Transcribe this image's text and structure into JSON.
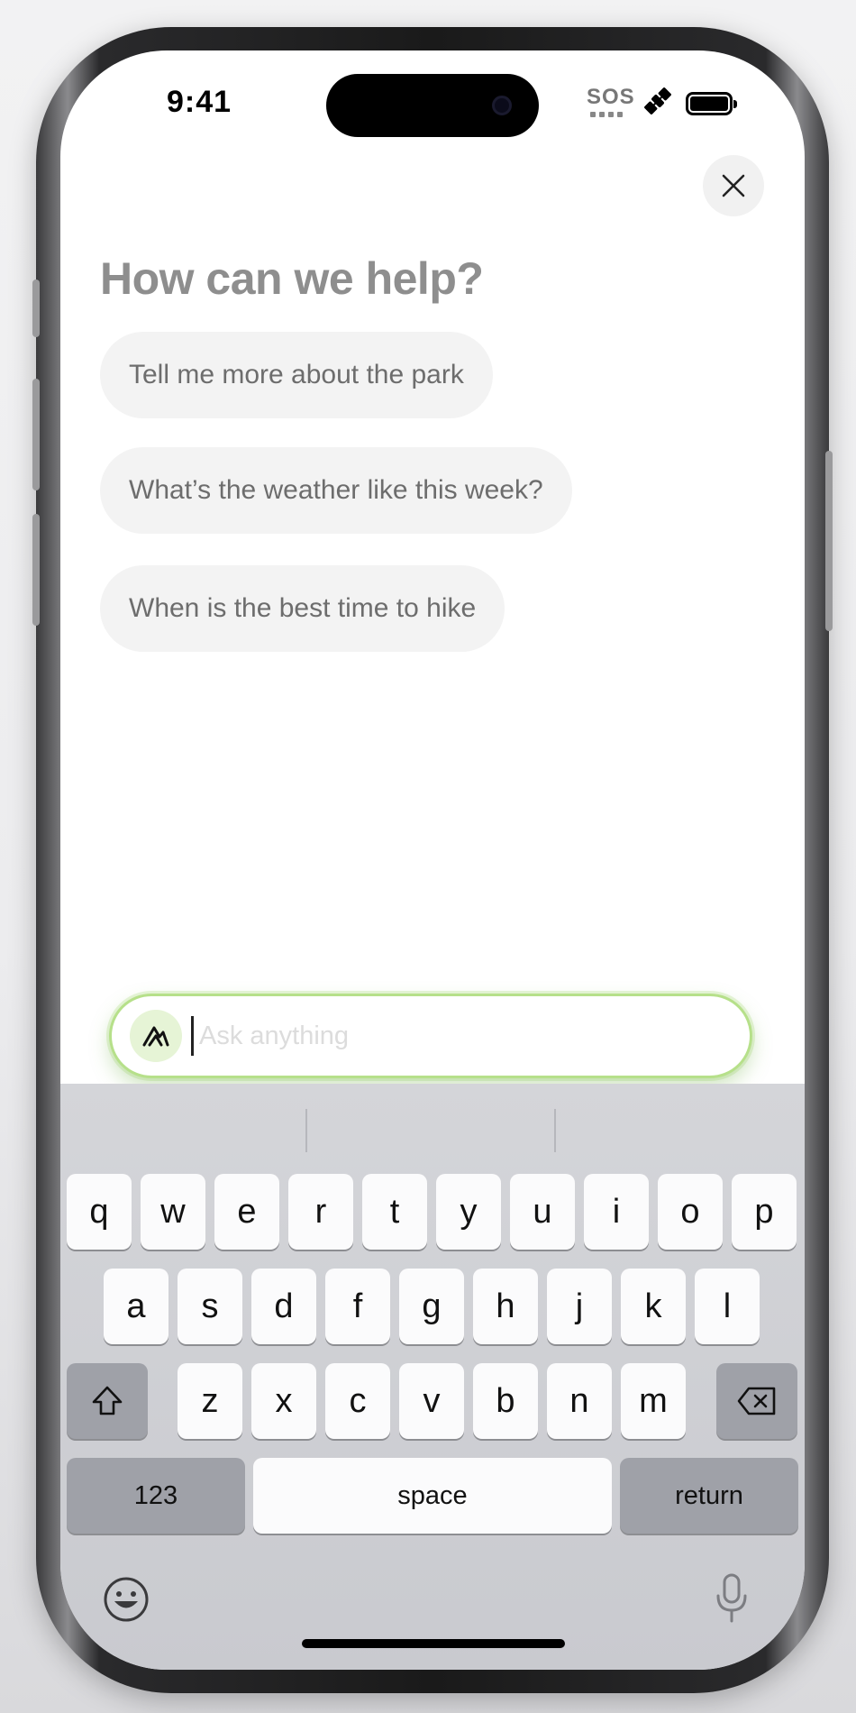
{
  "status_bar": {
    "time": "9:41",
    "sos_label": "SOS",
    "icons": [
      "satellite-icon",
      "battery-icon"
    ]
  },
  "assistant": {
    "heading": "How can we help?",
    "close_icon": "close-icon",
    "suggestions": [
      "Tell me more about the park",
      "What’s the weather like this week?",
      "When is the best time to hike"
    ],
    "input_placeholder": "Ask anything",
    "input_value": "",
    "accent_color": "#a9dc7a"
  },
  "keyboard": {
    "row1": [
      "q",
      "w",
      "e",
      "r",
      "t",
      "y",
      "u",
      "i",
      "o",
      "p"
    ],
    "row2": [
      "a",
      "s",
      "d",
      "f",
      "g",
      "h",
      "j",
      "k",
      "l"
    ],
    "row3": [
      "z",
      "x",
      "c",
      "v",
      "b",
      "n",
      "m"
    ],
    "numbers_label": "123",
    "space_label": "space",
    "return_label": "return",
    "icons": [
      "shift-icon",
      "delete-icon",
      "emoji-icon",
      "microphone-icon"
    ]
  }
}
